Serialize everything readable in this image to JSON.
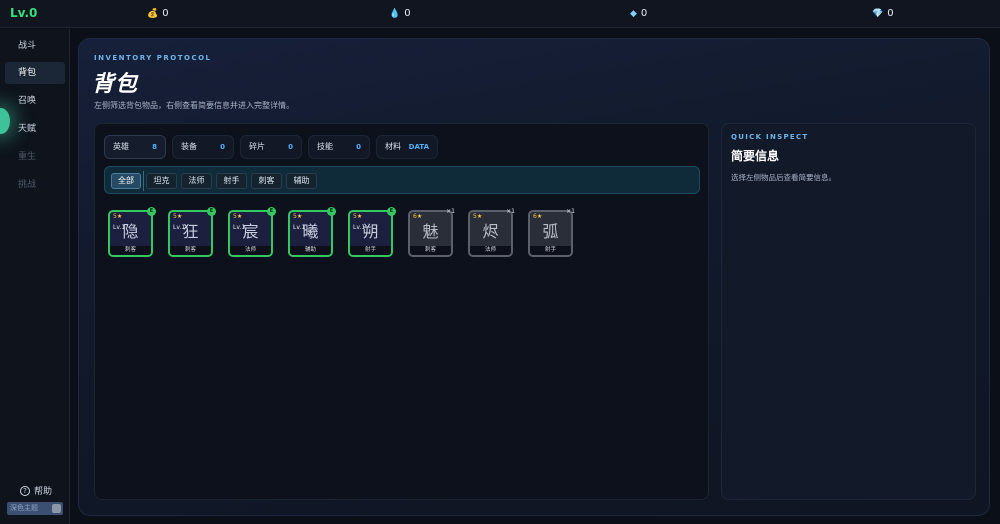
{
  "topbar": {
    "level": "Lv.0",
    "resources": [
      {
        "icon": "coin-bag-icon",
        "symbol": "💰",
        "value": "0"
      },
      {
        "icon": "water-drop-icon",
        "symbol": "💧",
        "value": "0"
      },
      {
        "icon": "diamond-icon",
        "symbol": "◆",
        "value": "0"
      },
      {
        "icon": "gem-icon",
        "symbol": "💎",
        "value": "0"
      }
    ]
  },
  "sidebar": {
    "items": [
      {
        "label": "战斗"
      },
      {
        "label": "背包"
      },
      {
        "label": "召唤"
      },
      {
        "label": "天赋"
      },
      {
        "label": "重生"
      },
      {
        "label": "挑战"
      }
    ],
    "help_label": "帮助",
    "help_icon": "?",
    "theme_label": "深色主题"
  },
  "header": {
    "eyebrow": "INVENTORY PROTOCOL",
    "title": "背包",
    "subtitle": "左侧筛选背包物品，右侧查看简要信息并进入完整详情。"
  },
  "categories": [
    {
      "label": "英雄",
      "count": "8"
    },
    {
      "label": "装备",
      "count": "0"
    },
    {
      "label": "碎片",
      "count": "0"
    },
    {
      "label": "技能",
      "count": "0"
    },
    {
      "label": "材料",
      "count": "DATA"
    }
  ],
  "filters": [
    {
      "label": "全部"
    },
    {
      "label": "坦克"
    },
    {
      "label": "法师"
    },
    {
      "label": "射手"
    },
    {
      "label": "刺客"
    },
    {
      "label": "辅助"
    }
  ],
  "heroes": [
    {
      "glyph": "隐",
      "stars": "5★",
      "level": "Lv.1",
      "badge": "E",
      "role": "刺客",
      "owned": true
    },
    {
      "glyph": "狂",
      "stars": "5★",
      "level": "Lv.1",
      "badge": "E",
      "role": "刺客",
      "owned": true
    },
    {
      "glyph": "宸",
      "stars": "5★",
      "level": "Lv.1",
      "badge": "E",
      "role": "法师",
      "owned": true
    },
    {
      "glyph": "曦",
      "stars": "5★",
      "level": "Lv.1",
      "badge": "E",
      "role": "辅助",
      "owned": true
    },
    {
      "glyph": "朔",
      "stars": "5★",
      "level": "Lv.1",
      "badge": "E",
      "role": "射手",
      "owned": true
    },
    {
      "glyph": "魅",
      "stars": "6★",
      "count": "×1",
      "role": "刺客",
      "owned": false
    },
    {
      "glyph": "烬",
      "stars": "5★",
      "count": "×1",
      "role": "法师",
      "owned": false
    },
    {
      "glyph": "弧",
      "stars": "6★",
      "count": "×1",
      "role": "射手",
      "owned": false
    }
  ],
  "inspect": {
    "eyebrow": "QUICK INSPECT",
    "title": "简要信息",
    "hint": "选择左侧物品后查看简要信息。"
  },
  "colors": {
    "accent_green": "#34c960",
    "accent_blue": "#4fb0ff",
    "star_gold": "#f3c94a"
  }
}
